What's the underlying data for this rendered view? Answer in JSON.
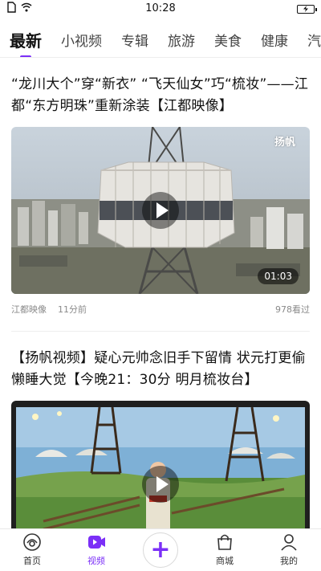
{
  "status_bar": {
    "time": "10:28"
  },
  "tabs": [
    {
      "label": "最新",
      "active": true
    },
    {
      "label": "小视频",
      "active": false
    },
    {
      "label": "专辑",
      "active": false
    },
    {
      "label": "旅游",
      "active": false
    },
    {
      "label": "美食",
      "active": false
    },
    {
      "label": "健康",
      "active": false
    },
    {
      "label": "汽车",
      "active": false
    }
  ],
  "feed": [
    {
      "title": "“龙川大个”穿“新衣” “飞天仙女”巧“梳妆”——江都“东方明珠”重新涂装【江都映像】",
      "brand_logo": "扬帆",
      "duration": "01:03",
      "source": "江都映像",
      "time_ago": "11分前",
      "views": "978看过"
    },
    {
      "title": "【扬帆视频】疑心元帅念旧手下留情 状元打更偷懒睡大觉【今晚21：30分 明月梳妆台】",
      "brand_logo": "",
      "duration": "",
      "source": "",
      "time_ago": "",
      "views": ""
    }
  ],
  "bottom_nav": {
    "home": "首页",
    "video": "视频",
    "mall": "商城",
    "mine": "我的"
  },
  "colors": {
    "accent": "#7b2ff7"
  }
}
